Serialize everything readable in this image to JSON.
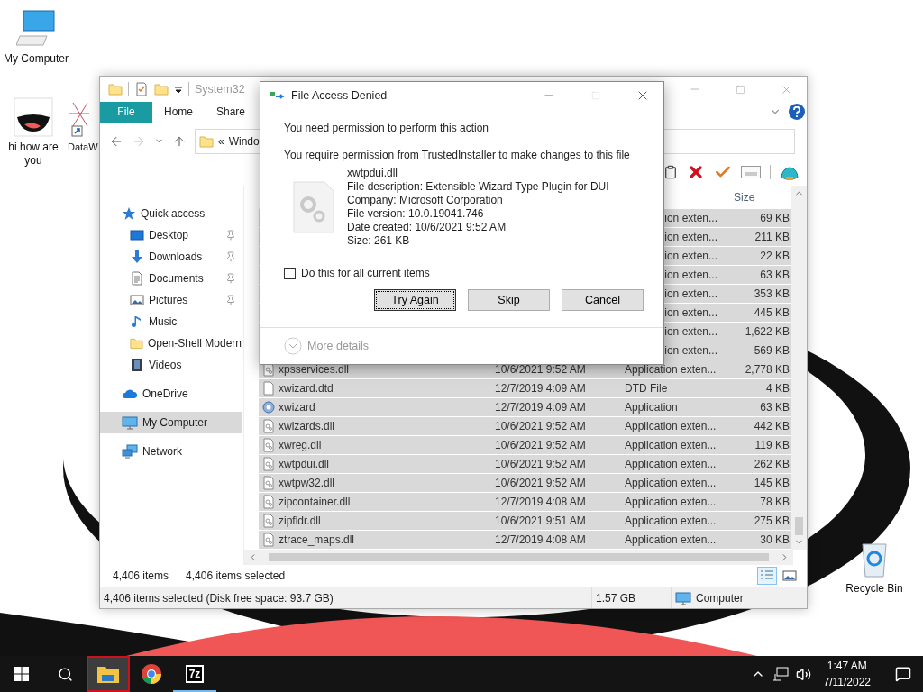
{
  "desktop_icons": [
    {
      "label": "My Computer",
      "kind": "computer"
    },
    {
      "label": "hi how are you",
      "kind": "cartoon"
    },
    {
      "label": "DataW",
      "kind": "shortcut"
    },
    {
      "label": "Recycle Bin",
      "kind": "recycle"
    }
  ],
  "explorer": {
    "title": "System32",
    "ribbon_tabs": [
      {
        "label": "File",
        "selected": true
      },
      {
        "label": "Home",
        "selected": false
      },
      {
        "label": "Share",
        "selected": false
      }
    ],
    "address": {
      "prefix": "«",
      "path": "Windo"
    },
    "nav": [
      {
        "label": "Quick access",
        "kind": "star",
        "selected": false,
        "children": [
          {
            "label": "Desktop",
            "kind": "desktop",
            "pinned": true,
            "selected": false
          },
          {
            "label": "Downloads",
            "kind": "download",
            "pinned": true,
            "selected": false
          },
          {
            "label": "Documents",
            "kind": "document",
            "pinned": true,
            "selected": false
          },
          {
            "label": "Pictures",
            "kind": "pictures",
            "pinned": true,
            "selected": false
          },
          {
            "label": "Music",
            "kind": "music",
            "pinned": false,
            "selected": false
          },
          {
            "label": "Open-Shell Modern",
            "kind": "folder",
            "pinned": false,
            "selected": false
          },
          {
            "label": "Videos",
            "kind": "videos",
            "pinned": false,
            "selected": false
          }
        ]
      },
      {
        "label": "OneDrive",
        "kind": "cloud",
        "selected": false
      },
      {
        "label": "My Computer",
        "kind": "computer",
        "selected": true
      },
      {
        "label": "Network",
        "kind": "network",
        "selected": false
      }
    ],
    "size_header": "Size",
    "rows": [
      {
        "type": "ion exten...",
        "size": "69 KB",
        "selected": true
      },
      {
        "type": "ion exten...",
        "size": "211 KB",
        "selected": true
      },
      {
        "type": "ion exten...",
        "size": "22 KB",
        "selected": true
      },
      {
        "type": "ion exten...",
        "size": "63 KB",
        "selected": true
      },
      {
        "type": "ion exten...",
        "size": "353 KB",
        "selected": true
      },
      {
        "type": "ion exten...",
        "size": "445 KB",
        "selected": true
      },
      {
        "type": "ion exten...",
        "size": "1,622 KB",
        "selected": true
      },
      {
        "type": "ion exten...",
        "size": "569 KB",
        "selected": true
      },
      {
        "name": "xpsservices.dll",
        "kind": "dll",
        "date": "10/6/2021 9:52 AM",
        "type": "Application exten...",
        "size": "2,778 KB",
        "selected": true
      },
      {
        "name": "xwizard.dtd",
        "kind": "dtd",
        "date": "12/7/2019 4:09 AM",
        "type": "DTD File",
        "size": "4 KB",
        "selected": true
      },
      {
        "name": "xwizard",
        "kind": "exe",
        "date": "12/7/2019 4:09 AM",
        "type": "Application",
        "size": "63 KB",
        "selected": true
      },
      {
        "name": "xwizards.dll",
        "kind": "dll",
        "date": "10/6/2021 9:52 AM",
        "type": "Application exten...",
        "size": "442 KB",
        "selected": true
      },
      {
        "name": "xwreg.dll",
        "kind": "dll",
        "date": "10/6/2021 9:52 AM",
        "type": "Application exten...",
        "size": "119 KB",
        "selected": true
      },
      {
        "name": "xwtpdui.dll",
        "kind": "dll",
        "date": "10/6/2021 9:52 AM",
        "type": "Application exten...",
        "size": "262 KB",
        "selected": true
      },
      {
        "name": "xwtpw32.dll",
        "kind": "dll",
        "date": "10/6/2021 9:52 AM",
        "type": "Application exten...",
        "size": "145 KB",
        "selected": true
      },
      {
        "name": "zipcontainer.dll",
        "kind": "dll",
        "date": "12/7/2019 4:08 AM",
        "type": "Application exten...",
        "size": "78 KB",
        "selected": true
      },
      {
        "name": "zipfldr.dll",
        "kind": "dll",
        "date": "10/6/2021 9:51 AM",
        "type": "Application exten...",
        "size": "275 KB",
        "selected": true
      },
      {
        "name": "ztrace_maps.dll",
        "kind": "dll",
        "date": "12/7/2019 4:08 AM",
        "type": "Application exten...",
        "size": "30 KB",
        "selected": true
      }
    ],
    "item_count": "4,406 items",
    "selected_count": "4,406 items selected",
    "views": [
      {
        "kind": "details",
        "selected": true
      },
      {
        "kind": "tiles",
        "selected": false
      }
    ],
    "status_bar": [
      "4,406 items selected (Disk free space: 93.7 GB)",
      "1.57 GB",
      "Computer"
    ]
  },
  "dialog": {
    "title": "File Access Denied",
    "heading": "You need permission to perform this action",
    "message": "You require permission from TrustedInstaller to make changes to this file",
    "file_lines": [
      "xwtpdui.dll",
      "File description: Extensible Wizard Type Plugin for DUI",
      "Company: Microsoft Corporation",
      "File version: 10.0.19041.746",
      "Date created: 10/6/2021 9:52 AM",
      "Size: 261 KB"
    ],
    "checkbox": {
      "label": "Do this for all current items",
      "checked": false
    },
    "buttons": [
      {
        "label": "Try Again",
        "focused": true
      },
      {
        "label": "Skip",
        "focused": false
      },
      {
        "label": "Cancel",
        "focused": false
      }
    ],
    "more_details": "More details"
  },
  "taskbar": {
    "apps": [
      {
        "kind": "explorer",
        "active": true,
        "running": true
      },
      {
        "kind": "chrome",
        "active": false,
        "running": false
      },
      {
        "kind": "sevenzip",
        "label": "7z",
        "active": false,
        "running": true
      }
    ],
    "time": "1:47 AM",
    "date": "7/11/2022"
  }
}
